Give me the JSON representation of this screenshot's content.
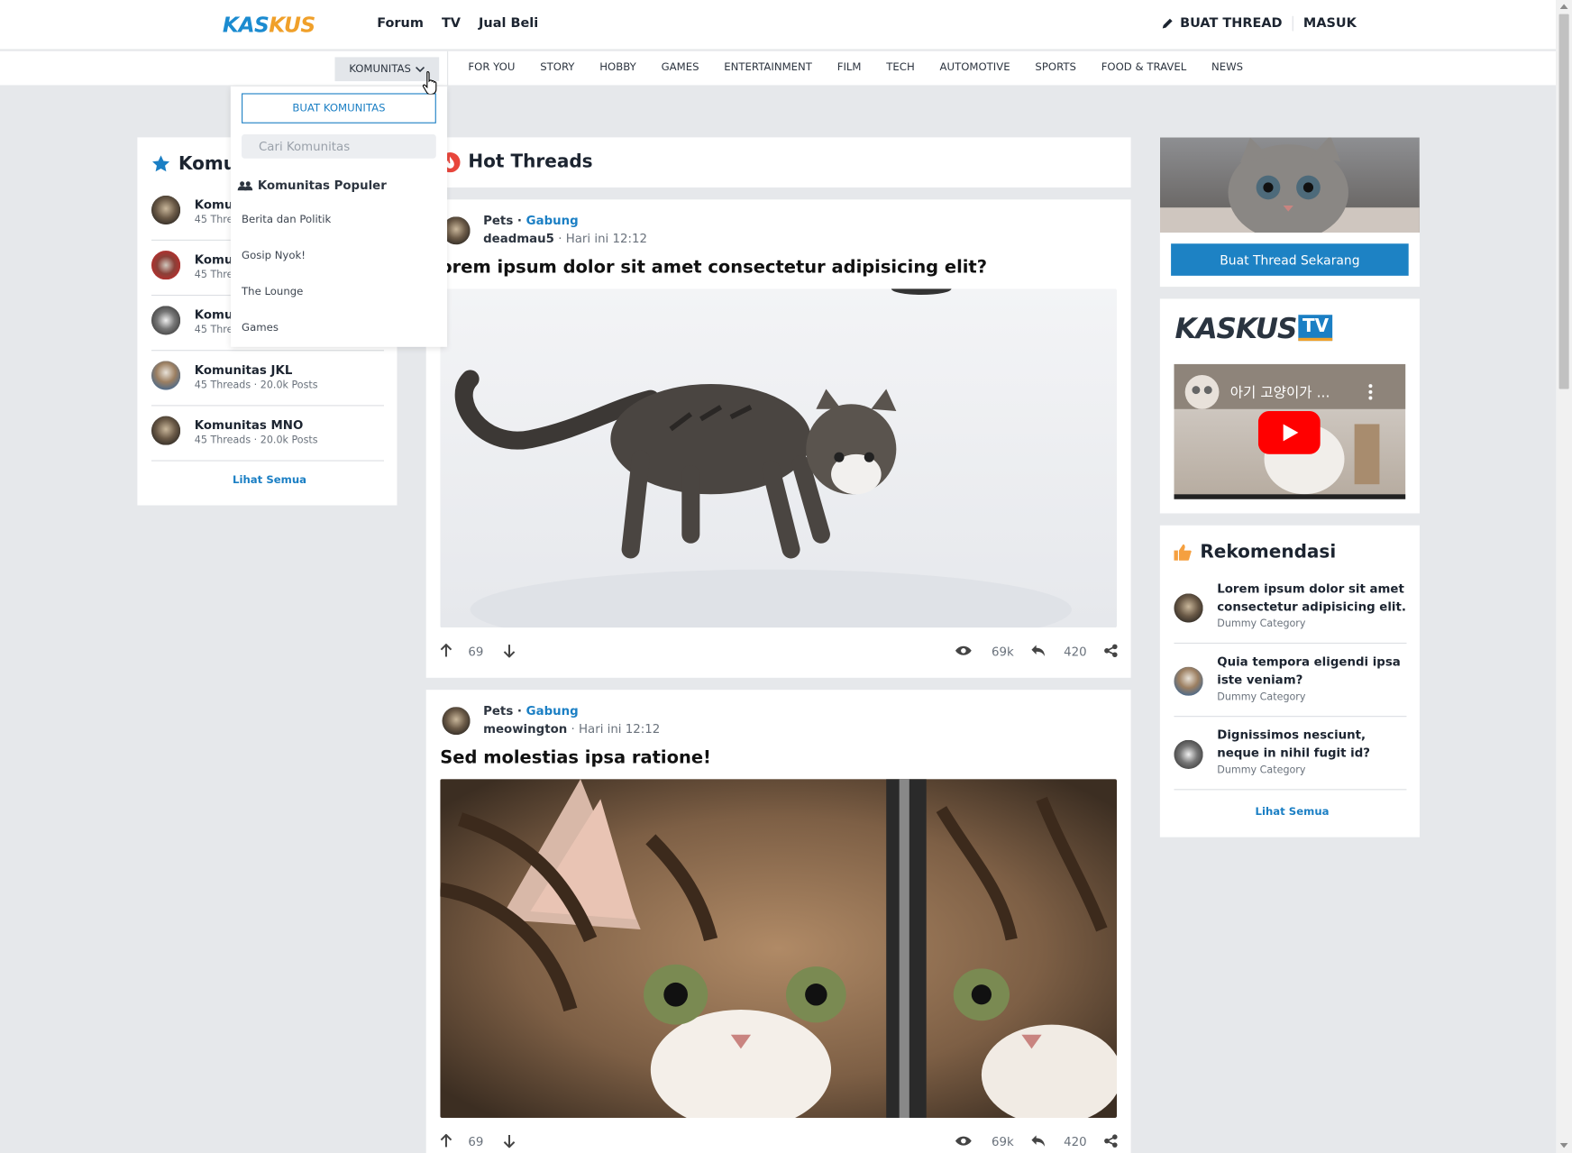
{
  "header": {
    "logo_text_1": "KAS",
    "logo_text_2": "KUS",
    "nav": [
      "Forum",
      "TV",
      "Jual Beli"
    ],
    "buat_thread": "BUAT THREAD",
    "masuk": "MASUK"
  },
  "category_bar": {
    "komunitas_label": "KOMUNITAS",
    "categories": [
      "FOR YOU",
      "STORY",
      "HOBBY",
      "GAMES",
      "ENTERTAINMENT",
      "FILM",
      "TECH",
      "AUTOMOTIVE",
      "SPORTS",
      "FOOD & TRAVEL",
      "NEWS"
    ]
  },
  "dropdown": {
    "buat_komunitas": "BUAT KOMUNITAS",
    "search_placeholder": "Cari Komunitas",
    "popular_heading": "Komunitas Populer",
    "items": [
      "Berita dan Politik",
      "Gosip Nyok!",
      "The Lounge",
      "Games"
    ]
  },
  "left_panel": {
    "title": "Komu",
    "communities": [
      {
        "name": "Komu",
        "meta": "45 Thre"
      },
      {
        "name": "Komu",
        "meta": "45 Thre"
      },
      {
        "name": "Komu",
        "meta": "45 Thre"
      },
      {
        "name": "Komunitas JKL",
        "meta": "45 Threads · 20.0k Posts"
      },
      {
        "name": "Komunitas MNO",
        "meta": "45 Threads · 20.0k Posts"
      }
    ],
    "lihat_semua": "Lihat Semua"
  },
  "hot_threads": {
    "title": "Hot Threads",
    "posts": [
      {
        "category": "Pets",
        "join": "Gabung",
        "user": "deadmau5",
        "time": "Hari ini 12:12",
        "title": "orem ipsum dolor sit amet consectetur adipisicing elit?",
        "upvotes": "69",
        "views": "69k",
        "replies": "420"
      },
      {
        "category": "Pets",
        "join": "Gabung",
        "user": "meowington",
        "time": "Hari ini 12:12",
        "title": "Sed molestias ipsa ratione!",
        "upvotes": "69",
        "views": "69k",
        "replies": "420"
      }
    ],
    "separator": " · "
  },
  "right_panel": {
    "cta_button": "Buat Thread Sekarang",
    "tv_logo_text": "KASKUS",
    "tv_badge": "TV",
    "video_title": "아기 고양이가 ...",
    "rekomendasi_title": "Rekomendasi",
    "recommendations": [
      {
        "title": "Lorem ipsum dolor sit amet consectetur adipisicing elit.",
        "category": "Dummy Category"
      },
      {
        "title": "Quia tempora eligendi ipsa iste veniam?",
        "category": "Dummy Category"
      },
      {
        "title": "Dignissimos nesciunt, neque in nihil fugit id?",
        "category": "Dummy Category"
      }
    ],
    "lihat_semua": "Lihat Semua"
  },
  "colors": {
    "brand_blue": "#1b8bd0",
    "brand_orange": "#f0a02a",
    "link_blue": "#1b7fc4",
    "cta_blue": "#1d82c4",
    "hot_red": "#e8463c",
    "star_blue": "#1b7fc4",
    "thumb_orange": "#f5a040",
    "youtube_red": "#ff0000"
  },
  "icons": {
    "pencil": "pencil-icon",
    "chevron": "chevron-down-icon",
    "users": "users-icon",
    "star": "star-icon",
    "fire": "fire-icon",
    "up": "arrow-up-icon",
    "down": "arrow-down-icon",
    "eye": "eye-icon",
    "reply": "reply-icon",
    "share": "share-icon",
    "thumb": "thumbs-up-icon",
    "play": "youtube-play-icon"
  }
}
